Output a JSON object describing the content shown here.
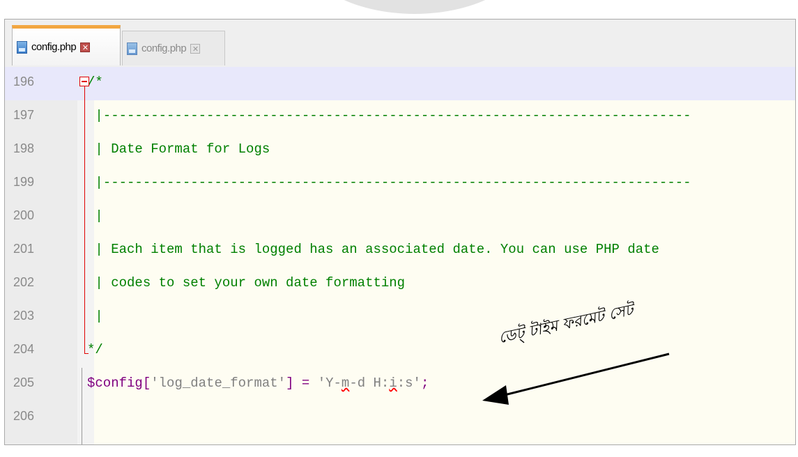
{
  "tabs": [
    {
      "label": "config.php",
      "active": true,
      "close_glyph": "✕"
    },
    {
      "label": "config.php",
      "active": false,
      "close_glyph": "✕"
    }
  ],
  "editor": {
    "lines": [
      {
        "num": "196",
        "kind": "comment",
        "text": "/*",
        "current": true
      },
      {
        "num": "197",
        "kind": "comment",
        "text": " |--------------------------------------------------------------------------"
      },
      {
        "num": "198",
        "kind": "comment",
        "text": " | Date Format for Logs"
      },
      {
        "num": "199",
        "kind": "comment",
        "text": " |--------------------------------------------------------------------------"
      },
      {
        "num": "200",
        "kind": "comment",
        "text": " |"
      },
      {
        "num": "201",
        "kind": "comment",
        "text": " | Each item that is logged has an associated date. You can use PHP date"
      },
      {
        "num": "202",
        "kind": "comment",
        "text": " | codes to set your own date formatting"
      },
      {
        "num": "203",
        "kind": "comment",
        "text": " |"
      },
      {
        "num": "204",
        "kind": "comment",
        "text": "*/"
      },
      {
        "num": "205",
        "kind": "code",
        "var": "$config",
        "open": "[",
        "key": "'log_date_format'",
        "close": "]",
        "eq": " = ",
        "val_a": "'Y-",
        "val_b": "m",
        "val_c": "-d H:",
        "val_d": "i",
        "val_e": ":s'",
        "semi": ";"
      },
      {
        "num": "206",
        "kind": "empty",
        "text": ""
      }
    ]
  },
  "annotation": {
    "text": "ডেট্ টাইম ফরমেট সেট"
  },
  "colors": {
    "comment": "#008000",
    "variable": "#800080",
    "string": "#808080",
    "fold_marker": "#e00000",
    "active_tab_accent": "#f2a640",
    "editor_bg": "#fefdf2",
    "current_line_bg": "#e8e8fb"
  },
  "icons": {
    "file": "file-icon",
    "close": "close-icon",
    "fold": "fold-collapse-icon",
    "arrow": "arrow-pointer-icon"
  }
}
